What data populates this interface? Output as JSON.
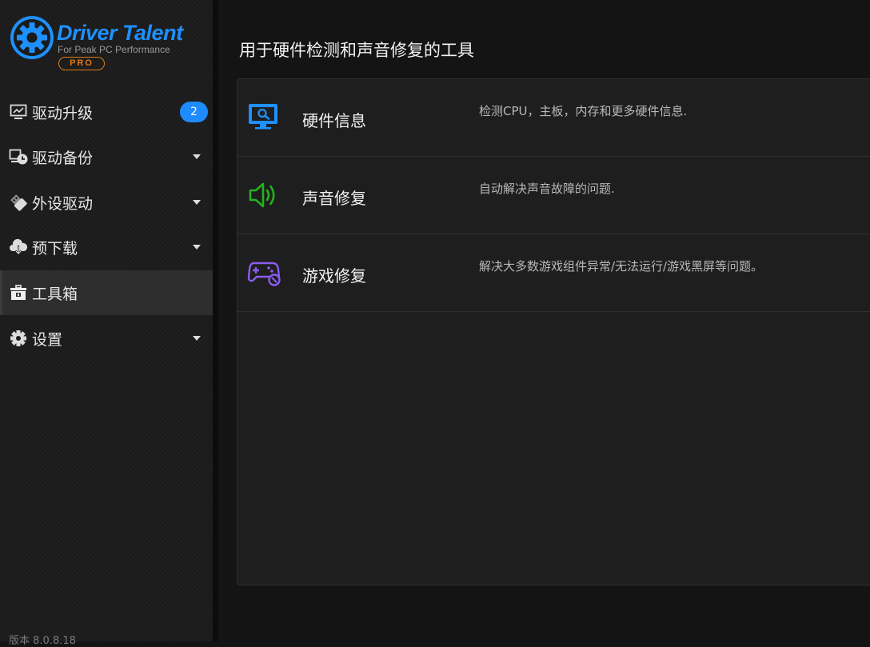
{
  "app": {
    "logo_title": "Driver Talent",
    "logo_subtitle": "For Peak PC Performance",
    "logo_badge": "PRO",
    "version": "版本 8.0.8.18"
  },
  "sidebar": {
    "items": [
      {
        "label": "驱动升级",
        "icon": "monitor-icon",
        "badge": "2"
      },
      {
        "label": "驱动备份",
        "icon": "backup-icon"
      },
      {
        "label": "外设驱动",
        "icon": "usb-icon"
      },
      {
        "label": "预下载",
        "icon": "cloud-download-icon"
      },
      {
        "label": "工具箱",
        "icon": "toolbox-icon",
        "active": true
      },
      {
        "label": "设置",
        "icon": "gear-icon"
      }
    ]
  },
  "main": {
    "title": "用于硬件检测和声音修复的工具",
    "tools": [
      {
        "name": "硬件信息",
        "desc": "检测CPU，主板，内存和更多硬件信息.",
        "icon": "hardware-monitor-icon",
        "color": "#1e90ff"
      },
      {
        "name": "声音修复",
        "desc": "自动解决声音故障的问题.",
        "icon": "speaker-icon",
        "color": "#22b31e"
      },
      {
        "name": "游戏修复",
        "desc": "解决大多数游戏组件异常/无法运行/游戏黑屏等问题。",
        "icon": "gamepad-icon",
        "color": "#8a5cf0"
      }
    ]
  },
  "colors": {
    "accent": "#1e90ff",
    "pro_orange": "#e07b18",
    "sidebar_bg": "#1b1b1b",
    "active_bg": "#2e2e2e"
  }
}
